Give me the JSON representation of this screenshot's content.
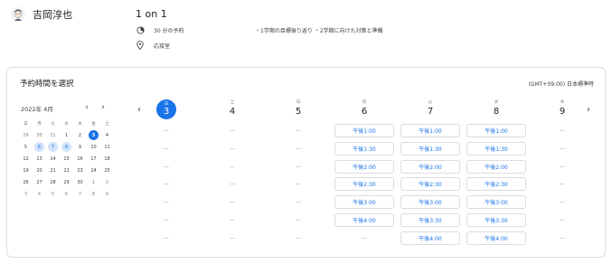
{
  "host": {
    "name": "吉岡淳也",
    "avatar_icon": "person-avatar-icon"
  },
  "event": {
    "title": "1 on 1",
    "duration": "30 分の予約",
    "description": "・1学期の目標振り返り ・2学期に向けた対策と準備",
    "location": "応接室"
  },
  "booking": {
    "title": "予約時間を選択",
    "timezone": "(GMT+09:00) 日本標準時"
  },
  "mini_calendar": {
    "month_label": "2022年 4月",
    "prev_icon": "chevron-left-icon",
    "next_icon": "chevron-right-icon",
    "weekdays": [
      "日",
      "月",
      "火",
      "水",
      "木",
      "金",
      "土"
    ],
    "weeks": [
      [
        {
          "d": "29",
          "t": "other"
        },
        {
          "d": "30",
          "t": "other"
        },
        {
          "d": "31",
          "t": "other"
        },
        {
          "d": "1",
          "t": ""
        },
        {
          "d": "2",
          "t": ""
        },
        {
          "d": "3",
          "t": "sel"
        },
        {
          "d": "4",
          "t": ""
        }
      ],
      [
        {
          "d": "5",
          "t": ""
        },
        {
          "d": "6",
          "t": "avail"
        },
        {
          "d": "7",
          "t": "avail"
        },
        {
          "d": "8",
          "t": "avail"
        },
        {
          "d": "9",
          "t": ""
        },
        {
          "d": "10",
          "t": ""
        },
        {
          "d": "11",
          "t": ""
        }
      ],
      [
        {
          "d": "12",
          "t": ""
        },
        {
          "d": "13",
          "t": ""
        },
        {
          "d": "14",
          "t": ""
        },
        {
          "d": "15",
          "t": ""
        },
        {
          "d": "16",
          "t": ""
        },
        {
          "d": "17",
          "t": ""
        },
        {
          "d": "18",
          "t": ""
        }
      ],
      [
        {
          "d": "19",
          "t": ""
        },
        {
          "d": "20",
          "t": ""
        },
        {
          "d": "21",
          "t": ""
        },
        {
          "d": "22",
          "t": ""
        },
        {
          "d": "23",
          "t": ""
        },
        {
          "d": "24",
          "t": ""
        },
        {
          "d": "25",
          "t": ""
        }
      ],
      [
        {
          "d": "26",
          "t": ""
        },
        {
          "d": "27",
          "t": ""
        },
        {
          "d": "28",
          "t": ""
        },
        {
          "d": "29",
          "t": ""
        },
        {
          "d": "30",
          "t": ""
        },
        {
          "d": "1",
          "t": "other"
        },
        {
          "d": "2",
          "t": "other"
        }
      ],
      [
        {
          "d": "3",
          "t": "other"
        },
        {
          "d": "4",
          "t": "other"
        },
        {
          "d": "5",
          "t": "other"
        },
        {
          "d": "6",
          "t": "other"
        },
        {
          "d": "7",
          "t": "other"
        },
        {
          "d": "8",
          "t": "other"
        },
        {
          "d": "9",
          "t": "other"
        }
      ]
    ]
  },
  "week": {
    "prev_icon": "chevron-left-icon",
    "next_icon": "chevron-right-icon",
    "days": [
      {
        "label": "日",
        "num": "3",
        "selected": true,
        "slots": [
          "—",
          "—",
          "—",
          "—",
          "—",
          "—",
          "—"
        ]
      },
      {
        "label": "土",
        "num": "4",
        "selected": false,
        "slots": [
          "—",
          "—",
          "—",
          "—",
          "—",
          "—",
          "—"
        ]
      },
      {
        "label": "日",
        "num": "5",
        "selected": false,
        "slots": [
          "—",
          "—",
          "—",
          "—",
          "—",
          "—",
          "—"
        ]
      },
      {
        "label": "月",
        "num": "6",
        "selected": false,
        "slots": [
          "午後1:00",
          "午後1:30",
          "午後2:00",
          "午後2:30",
          "午後3:00",
          "午後4:00",
          "—"
        ]
      },
      {
        "label": "火",
        "num": "7",
        "selected": false,
        "slots": [
          "午後1:00",
          "午後1:30",
          "午後2:00",
          "午後2:30",
          "午後3:00",
          "午後3:30",
          "午後4:00"
        ]
      },
      {
        "label": "水",
        "num": "8",
        "selected": false,
        "slots": [
          "午後1:00",
          "午後1:30",
          "午後2:00",
          "午後2:30",
          "午後3:00",
          "午後3:30",
          "午後4:00"
        ]
      },
      {
        "label": "木",
        "num": "9",
        "selected": false,
        "slots": [
          "—",
          "—",
          "—",
          "—",
          "—",
          "—",
          "—"
        ]
      }
    ]
  },
  "colors": {
    "accent": "#1a73e8",
    "accent_light": "#d2e3fc",
    "border": "#dadce0",
    "text": "#3c4043"
  }
}
